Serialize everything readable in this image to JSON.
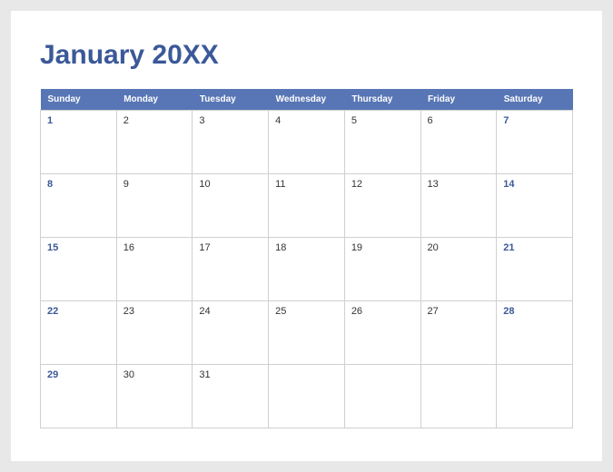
{
  "title": "January 20XX",
  "days": [
    "Sunday",
    "Monday",
    "Tuesday",
    "Wednesday",
    "Thursday",
    "Friday",
    "Saturday"
  ],
  "weeks": [
    [
      {
        "n": "1",
        "w": true
      },
      {
        "n": "2"
      },
      {
        "n": "3"
      },
      {
        "n": "4"
      },
      {
        "n": "5"
      },
      {
        "n": "6"
      },
      {
        "n": "7",
        "w": true
      }
    ],
    [
      {
        "n": "8",
        "w": true
      },
      {
        "n": "9"
      },
      {
        "n": "10"
      },
      {
        "n": "11"
      },
      {
        "n": "12"
      },
      {
        "n": "13"
      },
      {
        "n": "14",
        "w": true
      }
    ],
    [
      {
        "n": "15",
        "w": true
      },
      {
        "n": "16"
      },
      {
        "n": "17"
      },
      {
        "n": "18"
      },
      {
        "n": "19"
      },
      {
        "n": "20"
      },
      {
        "n": "21",
        "w": true
      }
    ],
    [
      {
        "n": "22",
        "w": true
      },
      {
        "n": "23"
      },
      {
        "n": "24"
      },
      {
        "n": "25"
      },
      {
        "n": "26"
      },
      {
        "n": "27"
      },
      {
        "n": "28",
        "w": true
      }
    ],
    [
      {
        "n": "29",
        "w": true
      },
      {
        "n": "30"
      },
      {
        "n": "31"
      },
      {
        "n": ""
      },
      {
        "n": ""
      },
      {
        "n": ""
      },
      {
        "n": ""
      }
    ]
  ]
}
